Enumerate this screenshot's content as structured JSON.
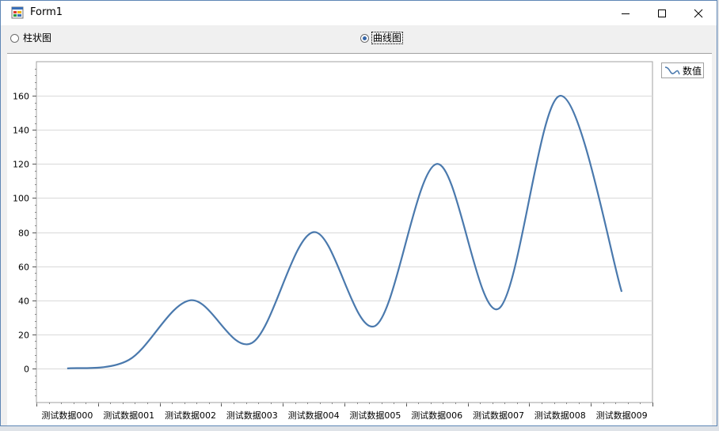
{
  "window": {
    "title": "Form1"
  },
  "chart_type_options": {
    "bar_label": "柱状图",
    "line_label": "曲线图",
    "selected": "line"
  },
  "legend": {
    "series_name": "数值"
  },
  "colors": {
    "series": "#4a79ad",
    "grid": "#d9d9d9",
    "axis": "#a0a0a0",
    "window_border": "#5e86b5"
  },
  "chart_data": {
    "type": "line",
    "smooth": true,
    "categories": [
      "测试数据000",
      "测试数据001",
      "测试数据002",
      "测试数据003",
      "测试数据004",
      "测试数据005",
      "测试数据006",
      "测试数据007",
      "测试数据008",
      "测试数据009"
    ],
    "series": [
      {
        "name": "数值",
        "values": [
          0,
          5,
          40,
          15,
          80,
          25,
          120,
          35,
          160,
          45
        ]
      }
    ],
    "title": "",
    "xlabel": "",
    "ylabel": "",
    "ylim": [
      -20,
      180
    ],
    "yticks": [
      0,
      20,
      40,
      60,
      80,
      100,
      120,
      140,
      160
    ],
    "grid": true,
    "legend_position": "top-right"
  }
}
